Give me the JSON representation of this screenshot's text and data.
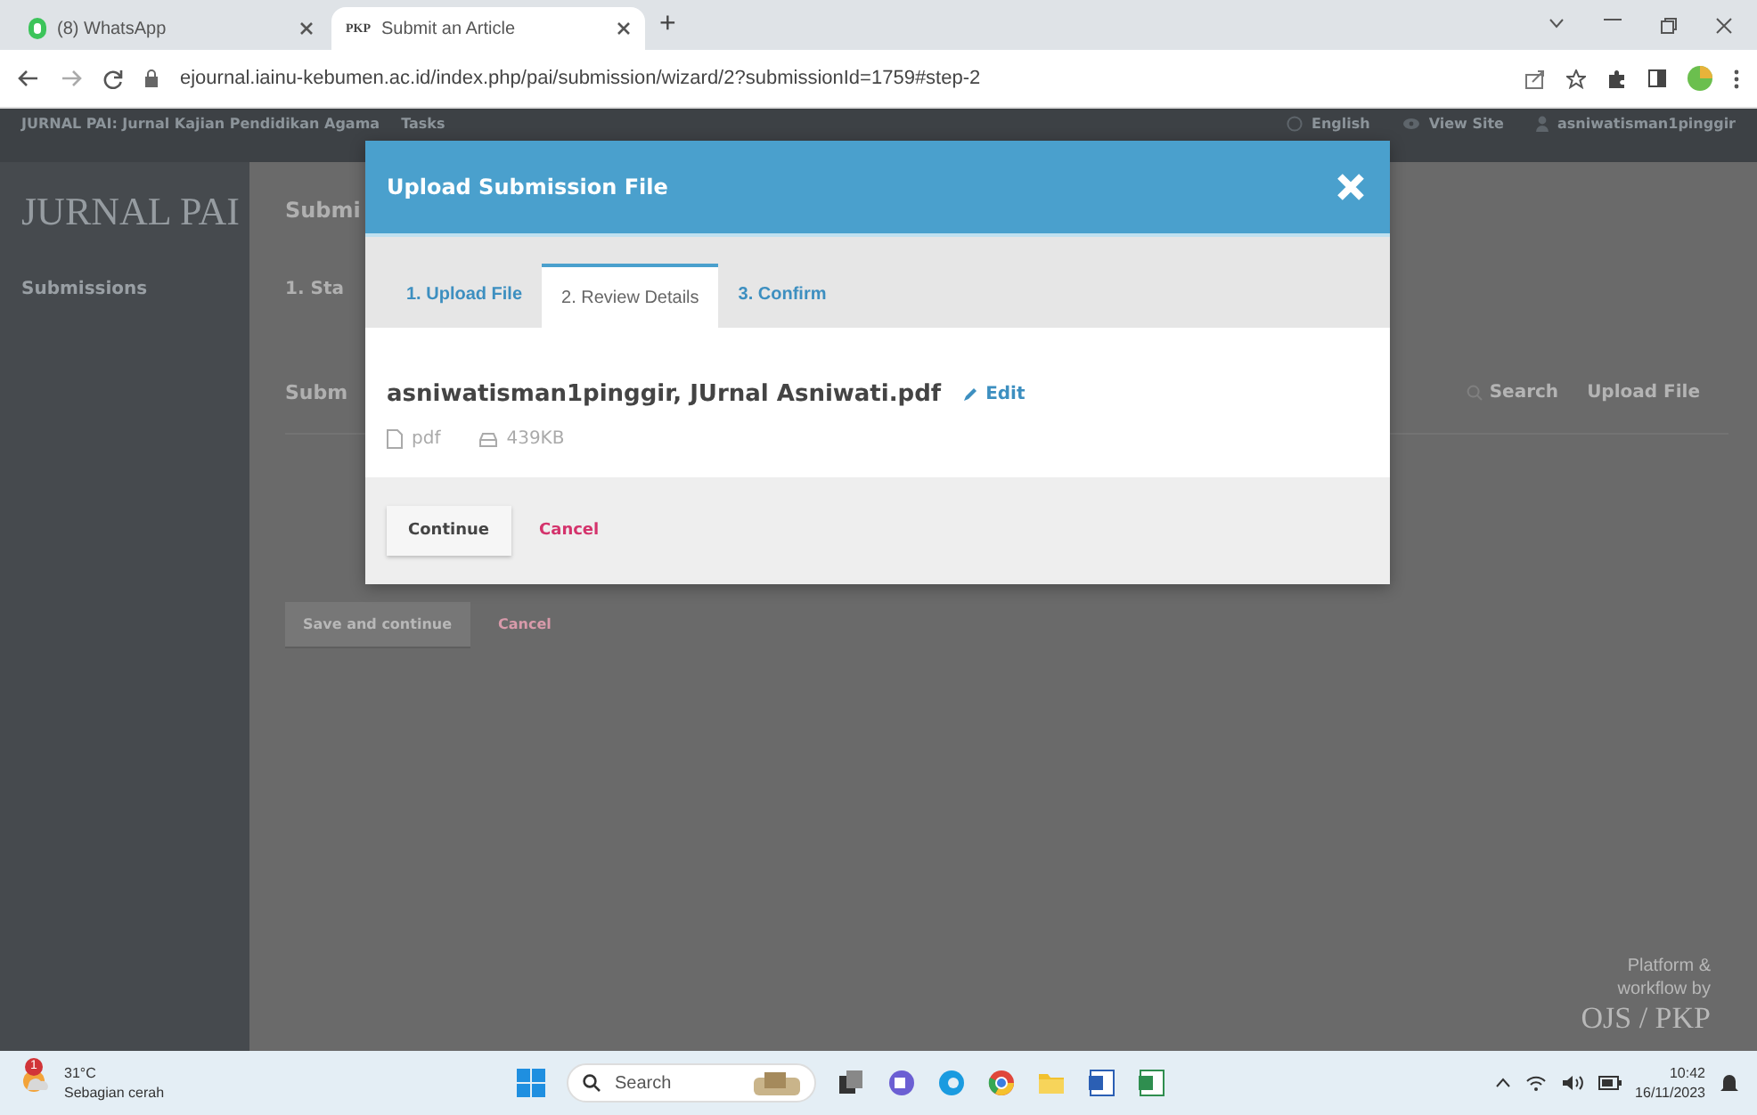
{
  "browser": {
    "tabs": [
      {
        "title": "(8) WhatsApp",
        "kind": "whatsapp",
        "selected": false
      },
      {
        "title": "Submit an Article",
        "kind": "pkp",
        "favicon_text": "PKP",
        "selected": true
      }
    ],
    "new_tab": "+",
    "url": "ejournal.iainu-kebumen.ac.id/index.php/pai/submission/wizard/2?submissionId=1759#step-2"
  },
  "site_header": {
    "title": "JURNAL PAI: Jurnal Kajian Pendidikan Agama",
    "tasks": "Tasks",
    "language": "English",
    "view_site": "View Site",
    "user": "asniwatisman1pinggir"
  },
  "sidebar": {
    "logo_title": "JURNAL PAI",
    "items": [
      {
        "label": "Submissions"
      }
    ]
  },
  "main": {
    "heading": "Submi",
    "step_tab": "1. Sta",
    "panel_title": "Subm",
    "search": "Search",
    "upload_file": "Upload File",
    "buttons": [
      {
        "label": "Save and continue",
        "kind": "primary"
      },
      {
        "label": "Cancel",
        "kind": "cancel"
      }
    ]
  },
  "footer_brand": {
    "text": "Platform & workflow by",
    "logo": "OJS / PKP"
  },
  "modal": {
    "title": "Upload Submission File",
    "tabs": [
      {
        "label": "1. Upload File",
        "selected": false
      },
      {
        "label": "2. Review Details",
        "selected": true
      },
      {
        "label": "3. Confirm",
        "selected": false
      }
    ],
    "file_name": "asniwatisman1pinggir, JUrnal Asniwati.pdf",
    "edit": "Edit",
    "file_type": "pdf",
    "file_size": "439KB",
    "buttons": [
      {
        "label": "Continue",
        "kind": "primary"
      },
      {
        "label": "Cancel",
        "kind": "cancel"
      }
    ]
  },
  "taskbar": {
    "weather": {
      "badge": "1",
      "temp": "31°C",
      "desc": "Sebagian cerah"
    },
    "search": "Search",
    "time": "10:42",
    "date": "16/11/2023"
  }
}
